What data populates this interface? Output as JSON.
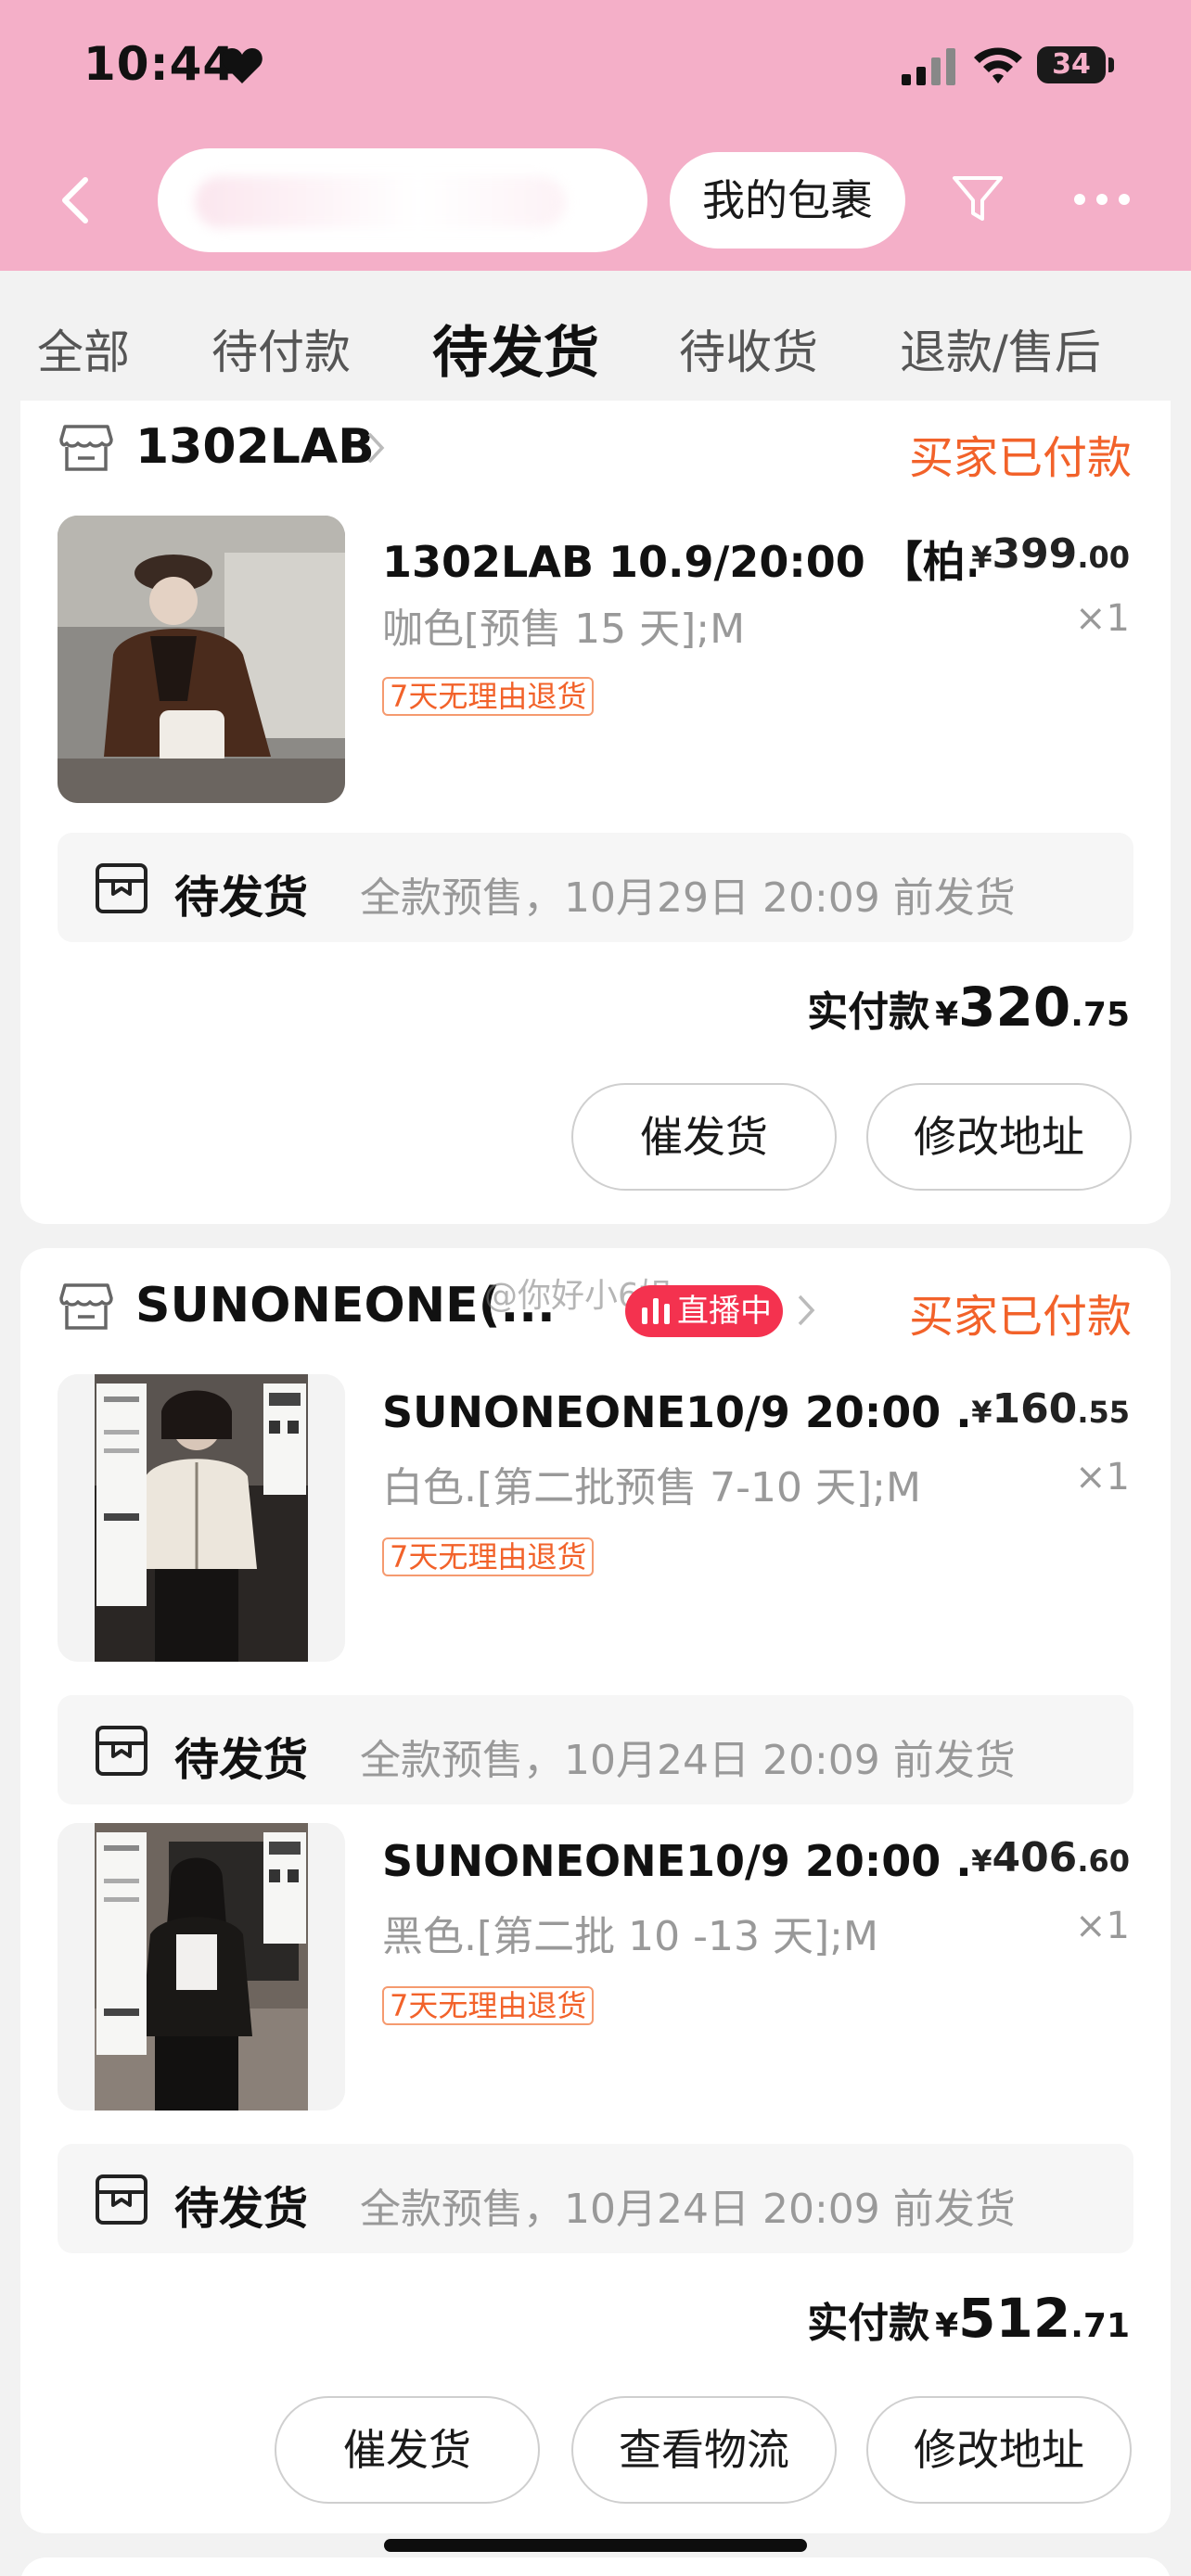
{
  "status_bar": {
    "time": "10:44",
    "battery": "34"
  },
  "header": {
    "my_packages": "我的包裹"
  },
  "tabs": [
    {
      "label": "全部"
    },
    {
      "label": "待付款"
    },
    {
      "label": "待发货"
    },
    {
      "label": "待收货"
    },
    {
      "label": "退款/售后"
    }
  ],
  "active_tab": "待发货",
  "orders": [
    {
      "shop": "1302LAB",
      "status": "买家已付款",
      "items": [
        {
          "title": "1302LAB 10.9/20:00 【柏...",
          "price_symbol": "¥",
          "price_int": "399",
          "price_dec": ".00",
          "spec": "咖色[预售 15 天];M",
          "qty": "×1",
          "tag": "7天无理由退货",
          "ship_status": "待发货",
          "ship_note": "全款预售，10月29日 20:09 前发货"
        }
      ],
      "total_label": "实付款",
      "total_symbol": "¥",
      "total_int": "320",
      "total_dec": ".75",
      "buttons": [
        "催发货",
        "修改地址"
      ]
    },
    {
      "shop": "SUNONEONE(...",
      "live_badge": "直播中",
      "watermark": "@你好小6姐",
      "status": "买家已付款",
      "items": [
        {
          "title": "SUNONEONE10/9 20:00 ...",
          "price_symbol": "¥",
          "price_int": "160",
          "price_dec": ".55",
          "spec": "白色.[第二批预售 7-10 天];M",
          "qty": "×1",
          "tag": "7天无理由退货",
          "ship_status": "待发货",
          "ship_note": "全款预售，10月24日 20:09 前发货"
        },
        {
          "title": "SUNONEONE10/9 20:00 ...",
          "price_symbol": "¥",
          "price_int": "406",
          "price_dec": ".60",
          "spec": "黑色.[第二批 10 -13 天];M",
          "qty": "×1",
          "tag": "7天无理由退货",
          "ship_status": "待发货",
          "ship_note": "全款预售，10月24日 20:09 前发货"
        }
      ],
      "total_label": "实付款",
      "total_symbol": "¥",
      "total_int": "512",
      "total_dec": ".71",
      "buttons": [
        "催发货",
        "查看物流",
        "修改地址"
      ]
    }
  ],
  "colors": {
    "header_pink": "#f4afc8",
    "accent_orange": "#f2622a",
    "live_red": "#f4324f"
  }
}
